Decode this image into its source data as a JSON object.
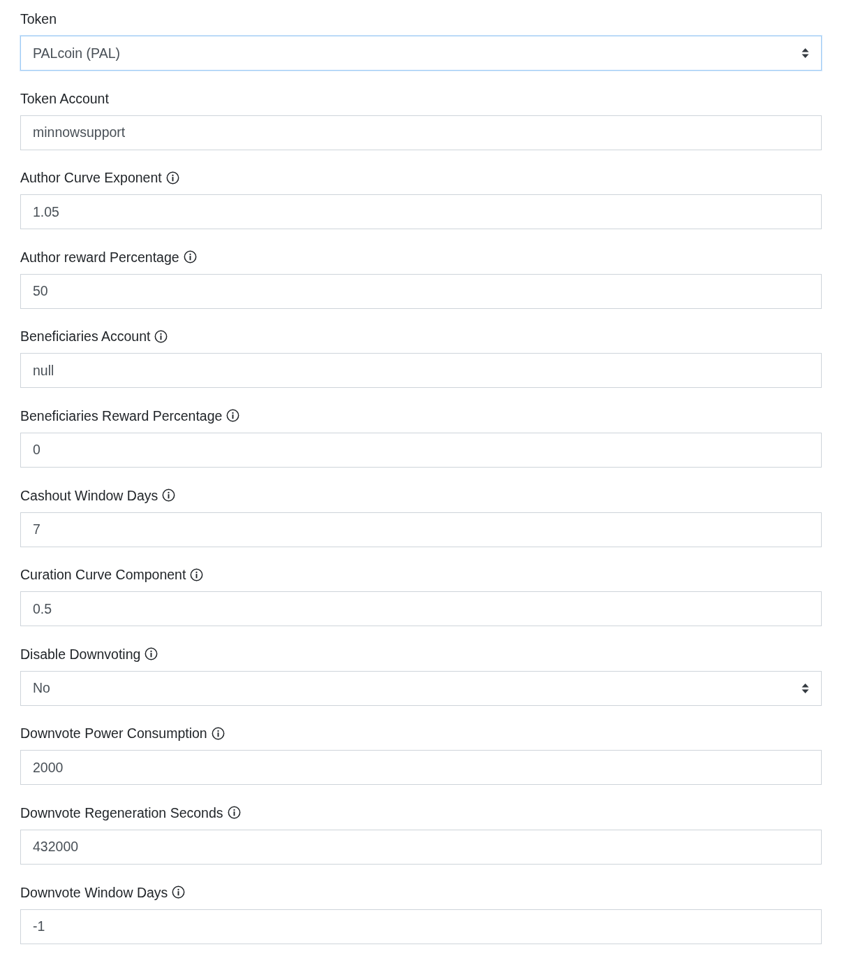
{
  "fields": [
    {
      "label": "Token",
      "info": false,
      "kind": "select",
      "value": "PALcoin (PAL)",
      "focused": true
    },
    {
      "label": "Token Account",
      "info": false,
      "kind": "text",
      "value": "minnowsupport",
      "focused": false
    },
    {
      "label": "Author Curve Exponent",
      "info": true,
      "kind": "text",
      "value": "1.05",
      "focused": false
    },
    {
      "label": "Author reward Percentage",
      "info": true,
      "kind": "text",
      "value": "50",
      "focused": false
    },
    {
      "label": "Beneficiaries Account",
      "info": true,
      "kind": "text",
      "value": "null",
      "focused": false
    },
    {
      "label": "Beneficiaries Reward Percentage",
      "info": true,
      "kind": "text",
      "value": "0",
      "focused": false
    },
    {
      "label": "Cashout Window Days",
      "info": true,
      "kind": "text",
      "value": "7",
      "focused": false
    },
    {
      "label": "Curation Curve Component",
      "info": true,
      "kind": "text",
      "value": "0.5",
      "focused": false
    },
    {
      "label": "Disable Downvoting",
      "info": true,
      "kind": "select",
      "value": "No",
      "focused": false
    },
    {
      "label": "Downvote Power Consumption",
      "info": true,
      "kind": "text",
      "value": "2000",
      "focused": false
    },
    {
      "label": "Downvote Regeneration Seconds",
      "info": true,
      "kind": "text",
      "value": "432000",
      "focused": false
    },
    {
      "label": "Downvote Window Days",
      "info": true,
      "kind": "text",
      "value": "-1",
      "focused": false
    }
  ]
}
